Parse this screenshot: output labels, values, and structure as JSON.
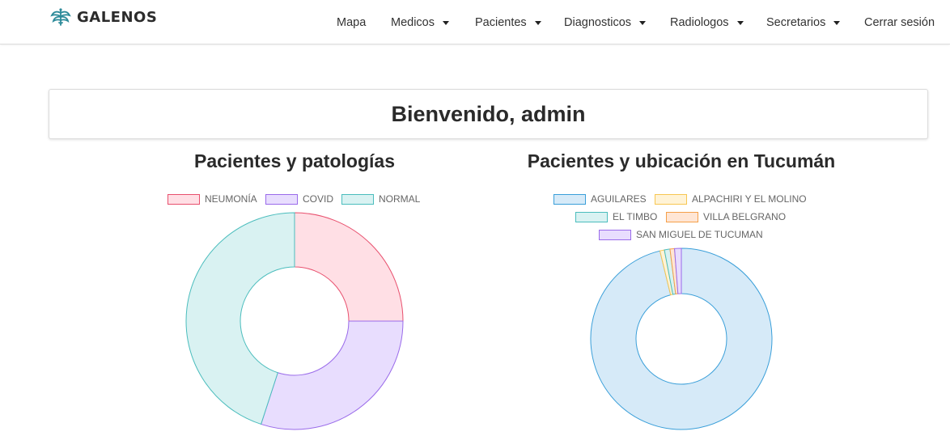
{
  "brand": {
    "name": "GALENOS",
    "icon": "caduceus-icon",
    "color": "#2c8a99"
  },
  "nav": {
    "items": [
      {
        "label": "Mapa",
        "dropdown": false
      },
      {
        "label": "Medicos",
        "dropdown": true
      },
      {
        "label": "Pacientes",
        "dropdown": true
      },
      {
        "label": "Diagnosticos",
        "dropdown": true
      },
      {
        "label": "Radiologos",
        "dropdown": true
      },
      {
        "label": "Secretarios",
        "dropdown": true
      },
      {
        "label": "Cerrar sesión",
        "dropdown": false
      }
    ]
  },
  "welcome": {
    "text": "Bienvenido, admin"
  },
  "chart_data": [
    {
      "type": "doughnut",
      "title": "Pacientes y patologías",
      "labels": [
        "NEUMONÍA",
        "COVID",
        "NORMAL"
      ],
      "values": [
        25,
        30,
        45
      ],
      "fill_colors": [
        "#ffdfe5",
        "#e8ddfe",
        "#d9f2f2"
      ],
      "border_colors": [
        "#e8506e",
        "#9a6bea",
        "#4bbdbd"
      ],
      "legend": "top"
    },
    {
      "type": "doughnut",
      "title": "Pacientes y ubicación en Tucumán",
      "labels": [
        "AGUILARES",
        "ALPACHIRI Y EL MOLINO",
        "EL TIMBO",
        "VILLA BELGRANO",
        "SAN MIGUEL DE TUCUMAN"
      ],
      "values": [
        96.2,
        0.8,
        1.0,
        0.8,
        1.2
      ],
      "fill_colors": [
        "#d6eaf8",
        "#fff3d6",
        "#d9f2f2",
        "#ffe6d5",
        "#e8ddfe"
      ],
      "border_colors": [
        "#3a9fd9",
        "#f7c752",
        "#4bbdbd",
        "#f5a04a",
        "#9a6bea"
      ],
      "legend": "top"
    }
  ]
}
